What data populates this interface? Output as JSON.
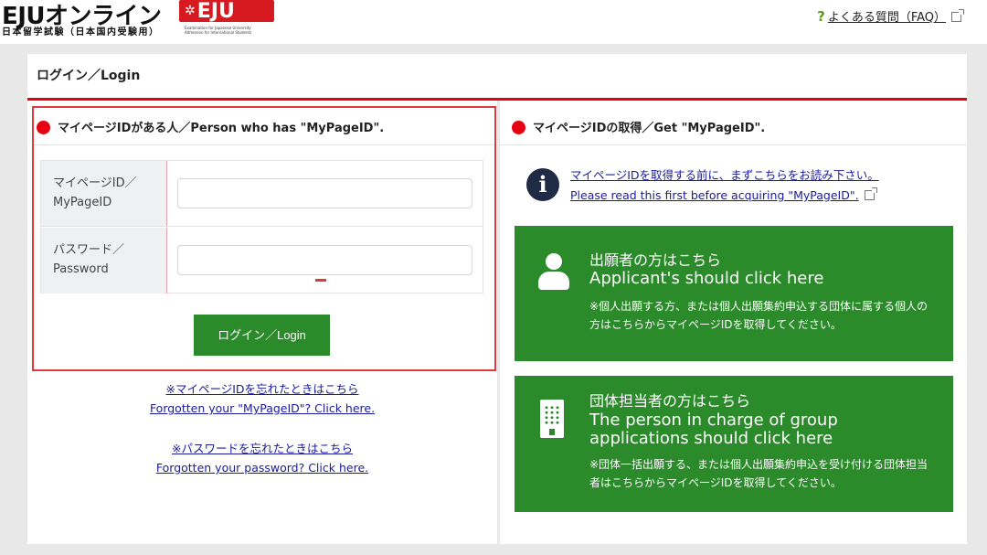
{
  "header": {
    "logo_main": "EJUオンライン",
    "logo_badge": "EJU",
    "logo_sub": "日本留学試験（日本国内受験用）",
    "logo_tiny": "Examination for Japanese University Admission for International Students",
    "faq_label": "よくある質問（FAQ）"
  },
  "panel": {
    "title": "ログイン／Login"
  },
  "login_section": {
    "title": "マイページIDがある人／Person who has \"MyPageID\".",
    "fields": [
      {
        "label_ja": "マイページID／",
        "label_en": "MyPageID",
        "value": ""
      },
      {
        "label_ja": "パスワード／",
        "label_en": "Password",
        "value": ""
      }
    ],
    "login_button": "ログイン／Login",
    "forgot_id_ja": "※マイページIDを忘れたときはこちら",
    "forgot_id_en": "Forgotten your \"MyPageID\"? Click here.",
    "forgot_pw_ja": "※パスワードを忘れたときはこちら",
    "forgot_pw_en": "Forgotten your password? Click here."
  },
  "acquire_section": {
    "title": "マイページIDの取得／Get \"MyPageID\".",
    "info_link_ja": "マイページIDを取得する前に、まずこちらをお読み下さい。",
    "info_link_en": "Please read this first before acquiring \"MyPageID\".",
    "applicant": {
      "title_ja": "出願者の方はこちら",
      "title_en": "Applicant's should click here",
      "note": "※個人出願する方、または個人出願集約申込する団体に属する個人の方はこちらからマイページIDを取得してください。"
    },
    "group": {
      "title_ja": "団体担当者の方はこちら",
      "title_en": "The person in charge of group applications should click here",
      "note": "※団体一括出願する、または個人出願集約申込を受け付ける団体担当者はこちらからマイページIDを取得してください。"
    }
  },
  "colors": {
    "accent_red": "#e60012",
    "button_green": "#2b8a2a",
    "link_blue": "#1a1aa0"
  }
}
